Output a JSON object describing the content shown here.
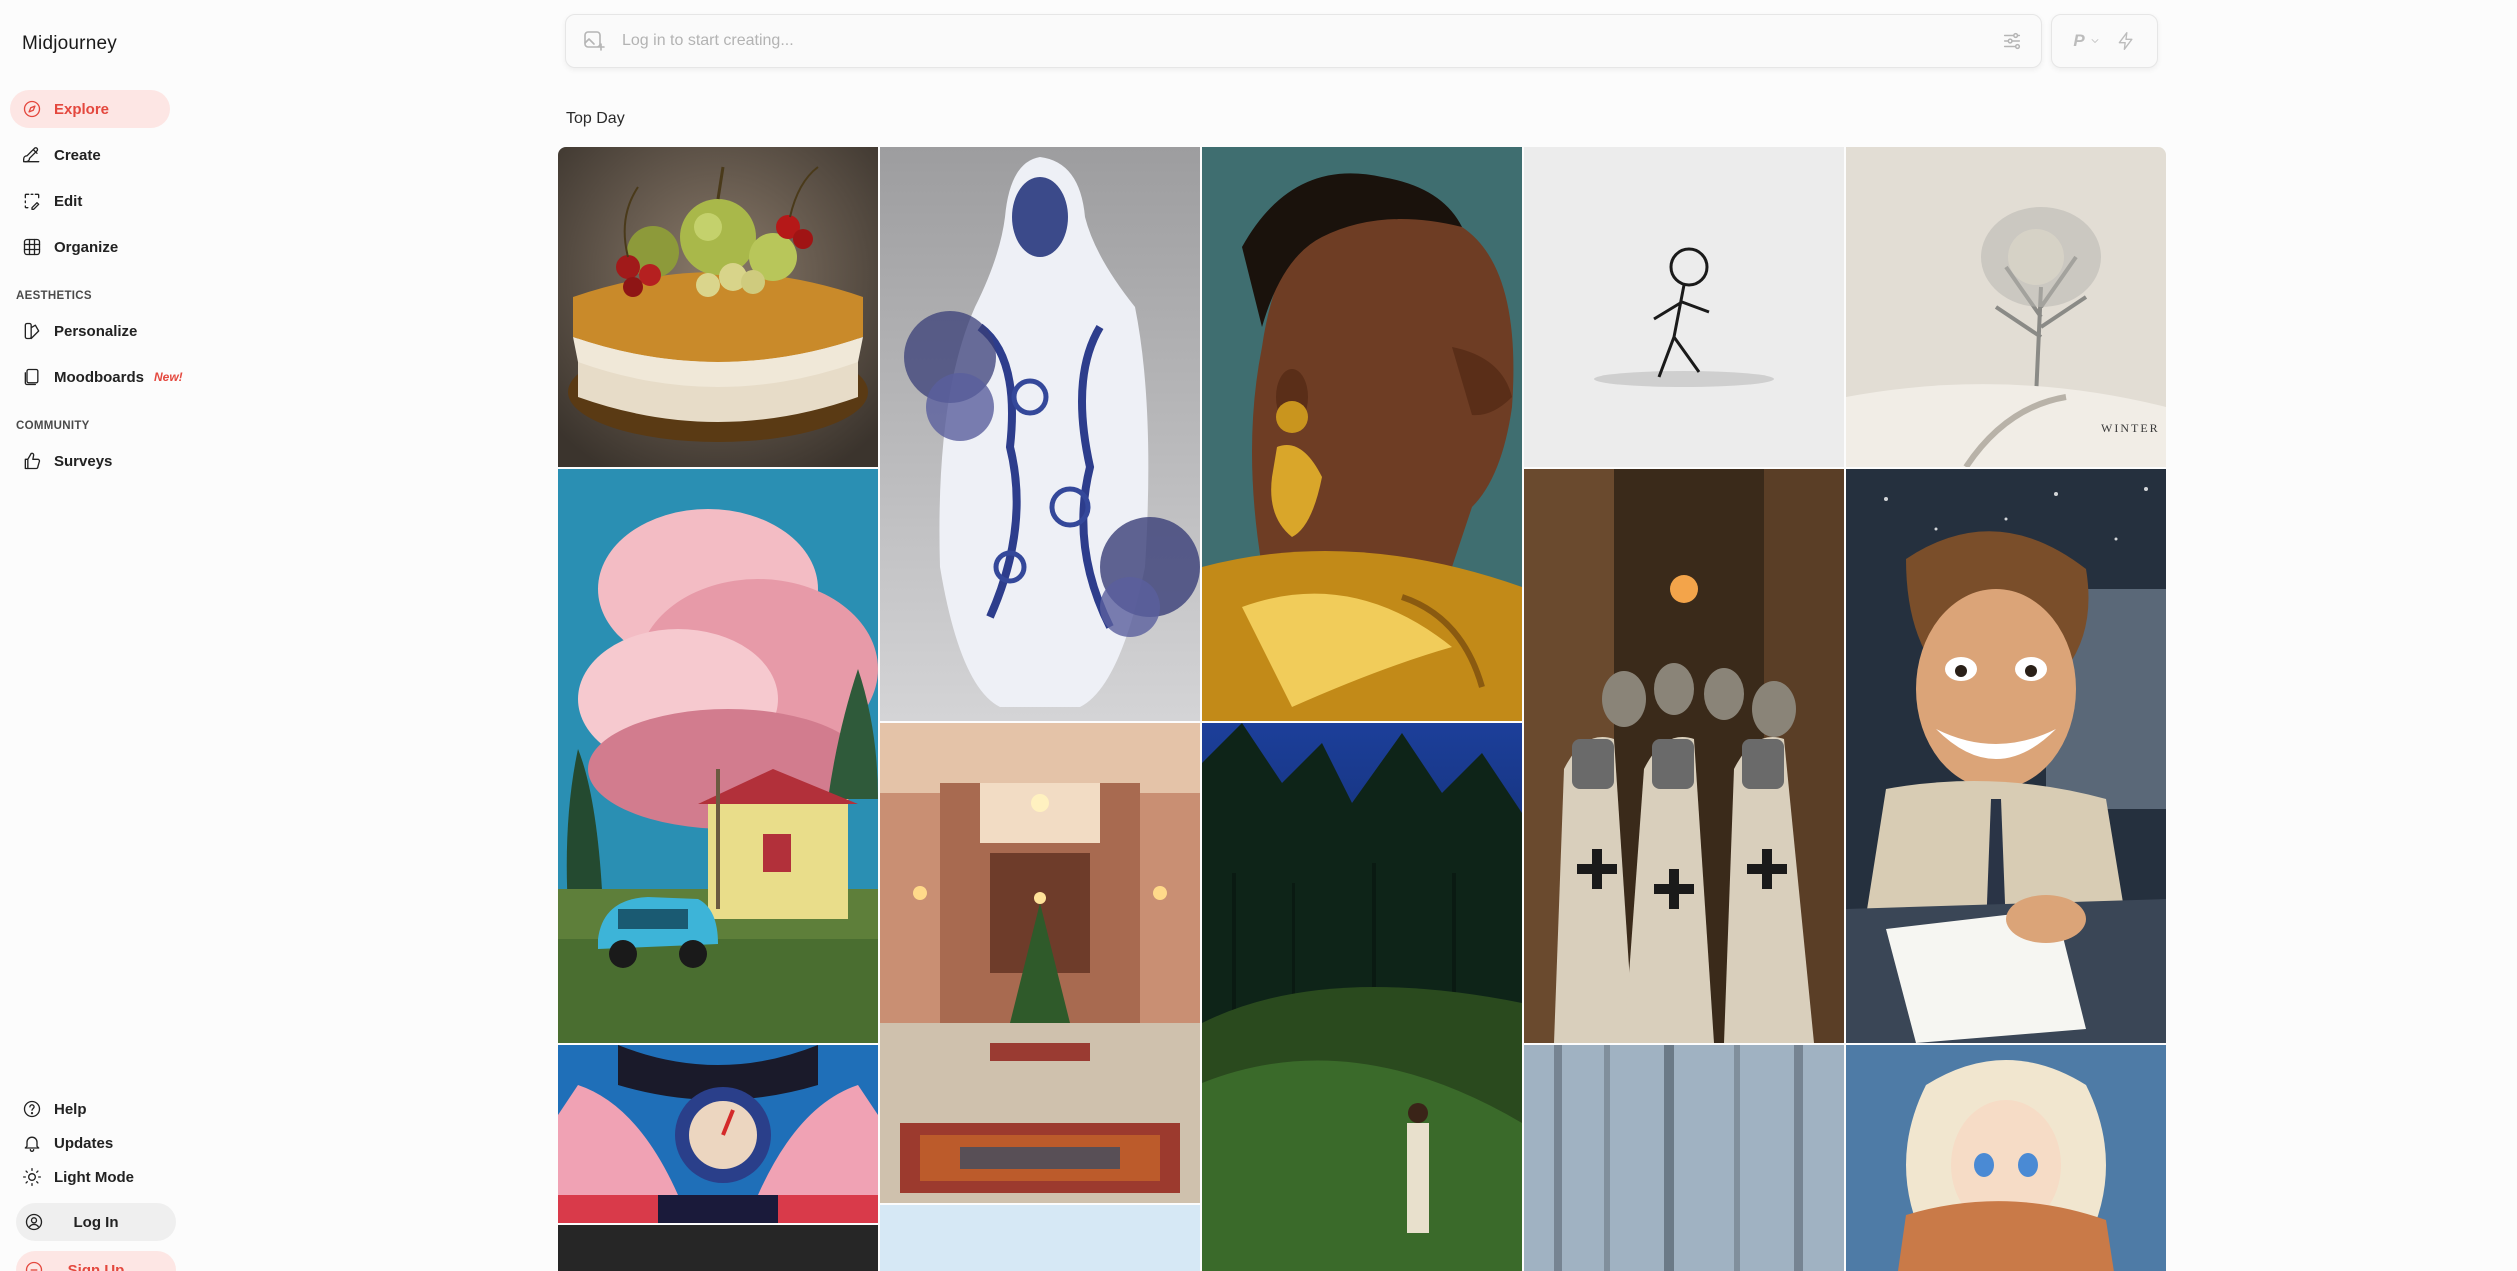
{
  "app": {
    "brand": "Midjourney"
  },
  "sidebar": {
    "nav": [
      {
        "label": "Explore",
        "icon": "compass-icon",
        "active": true
      },
      {
        "label": "Create",
        "icon": "brush-icon"
      },
      {
        "label": "Edit",
        "icon": "edit-image-icon"
      },
      {
        "label": "Organize",
        "icon": "grid-icon"
      }
    ],
    "aesthetics_label": "AESTHETICS",
    "aesthetics": [
      {
        "label": "Personalize",
        "icon": "personalize-icon"
      },
      {
        "label": "Moodboards",
        "icon": "moodboard-icon",
        "badge": "New!"
      }
    ],
    "community_label": "COMMUNITY",
    "community": [
      {
        "label": "Surveys",
        "icon": "thumbs-up-icon"
      }
    ],
    "bottom": [
      {
        "label": "Help",
        "icon": "help-icon"
      },
      {
        "label": "Updates",
        "icon": "bell-icon"
      },
      {
        "label": "Light Mode",
        "icon": "sun-icon"
      }
    ],
    "login_label": "Log In",
    "signup_label": "Sign Up"
  },
  "prompt": {
    "placeholder": "Log in to start creating..."
  },
  "mode": {
    "letter": "P"
  },
  "main": {
    "section_title": "Top Day"
  },
  "gallery": [
    {
      "name": "fruit-tart-image"
    },
    {
      "name": "porcelain-figure-image"
    },
    {
      "name": "gold-earring-portrait-image"
    },
    {
      "name": "stick-figure-image"
    },
    {
      "name": "winter-tree-image",
      "caption": "WINTER"
    },
    {
      "name": "pink-clouds-car-image"
    },
    {
      "name": "knights-crowd-image"
    },
    {
      "name": "clay-man-writing-image"
    },
    {
      "name": "hotel-lobby-image"
    },
    {
      "name": "night-forest-figure-image"
    },
    {
      "name": "anime-hands-image"
    },
    {
      "name": "misty-forest-image"
    },
    {
      "name": "white-hair-girl-image"
    },
    {
      "name": "dark-tile-image"
    },
    {
      "name": "sky-tile-image"
    }
  ],
  "colors": {
    "accent": "#e4483e",
    "accent_bg": "#fde6e4"
  }
}
